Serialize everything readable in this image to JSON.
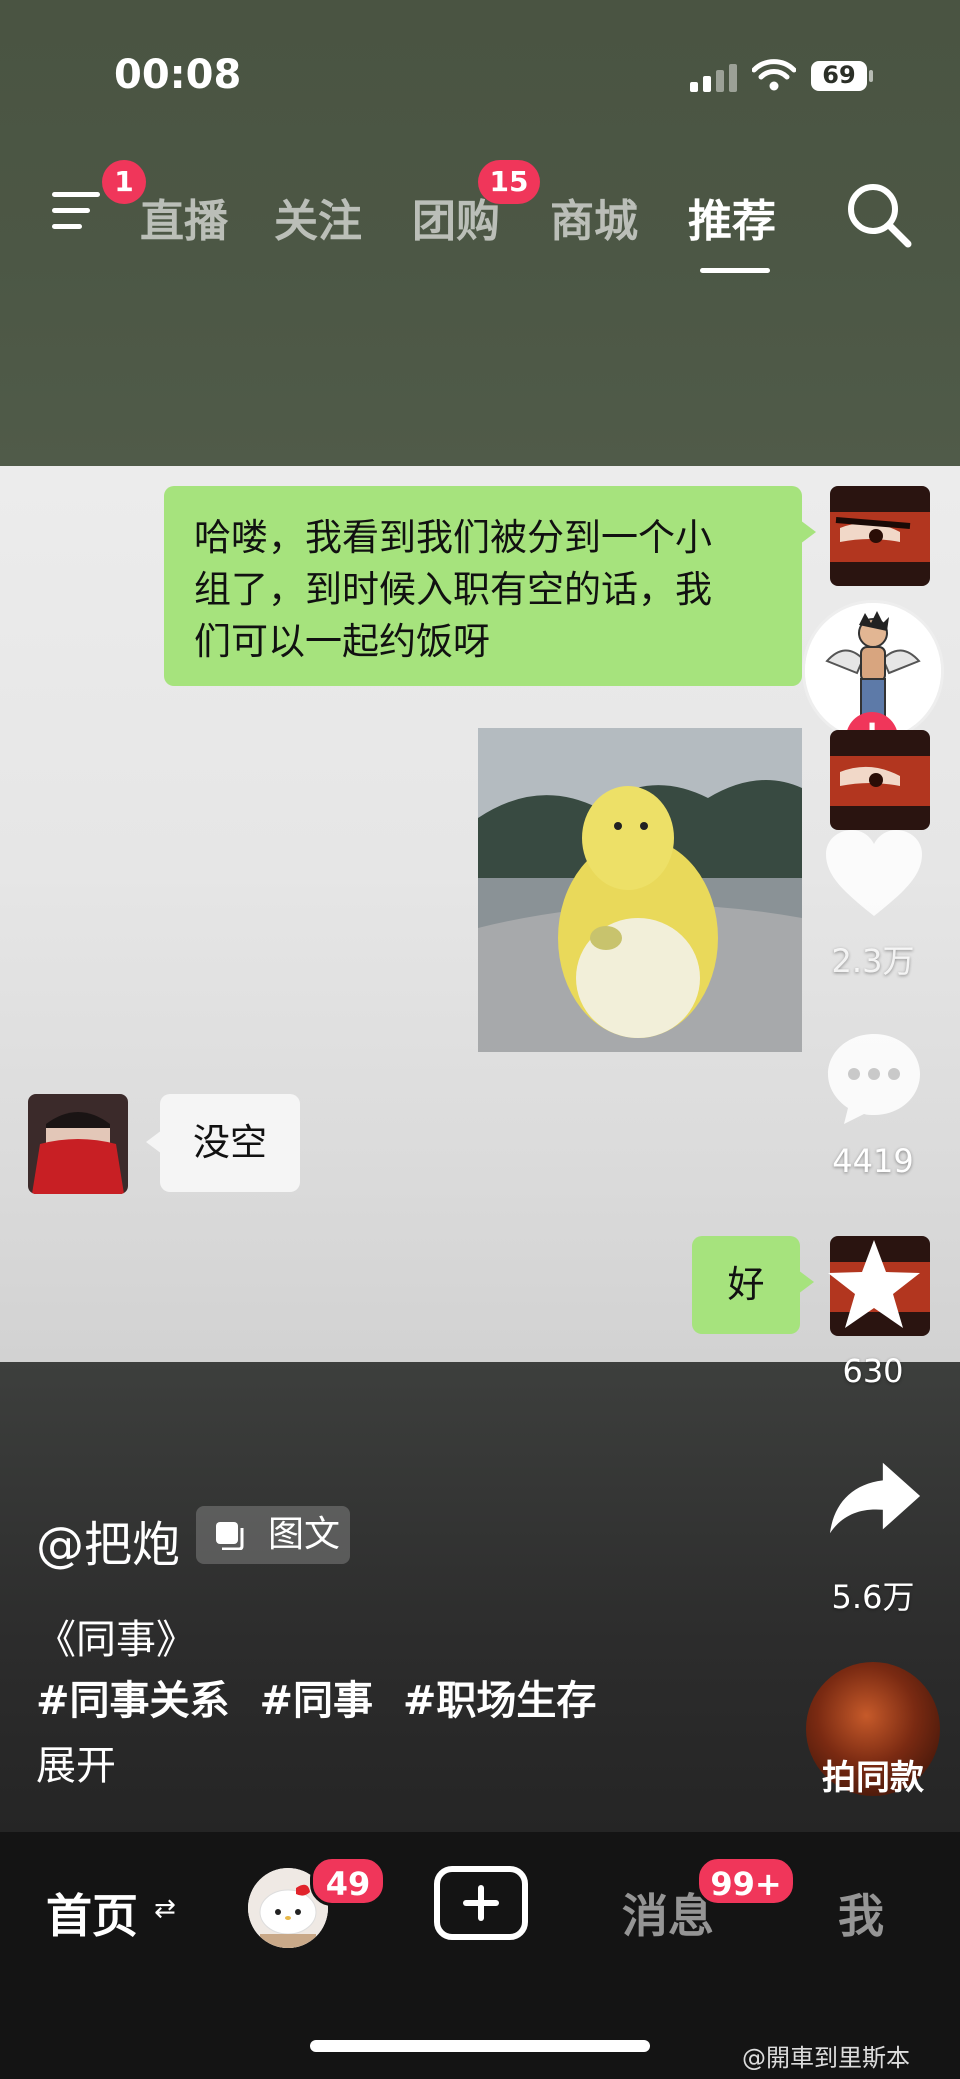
{
  "status_bar": {
    "time": "00:08",
    "battery": "69"
  },
  "top_nav": {
    "menu_badge": "1",
    "tabs": [
      {
        "label": "直播"
      },
      {
        "label": "关注"
      },
      {
        "label": "团购",
        "badge": "15"
      },
      {
        "label": "商城"
      },
      {
        "label": "推荐",
        "active": true
      }
    ]
  },
  "chat": {
    "msg1_lines": [
      "哈喽，我看到我们被分到一个小",
      "组了，到时候入职有空的话，我",
      "们可以一起约饭呀"
    ],
    "reply": "没空",
    "ok": "好"
  },
  "actions": {
    "likes": "2.3万",
    "comments": "4419",
    "favorites": "630",
    "shares": "5.6万",
    "follow": "+"
  },
  "caption": {
    "author": "@把炮",
    "type_tag": "图文",
    "title": "《同事》",
    "hashtags": [
      "#同事关系",
      "#同事",
      "#职场生存"
    ],
    "expand": "展开"
  },
  "music": {
    "label": "拍同款"
  },
  "tabbar": {
    "home": "首页",
    "home_arrows": "⇄",
    "friends_badge": "49",
    "messages": "消息",
    "messages_badge": "99+",
    "me": "我"
  },
  "watermark": "@開車到里斯本",
  "colors": {
    "accent": "#f0365a",
    "chat_green": "#a6e37d",
    "nav_bg": "#4a5442"
  }
}
